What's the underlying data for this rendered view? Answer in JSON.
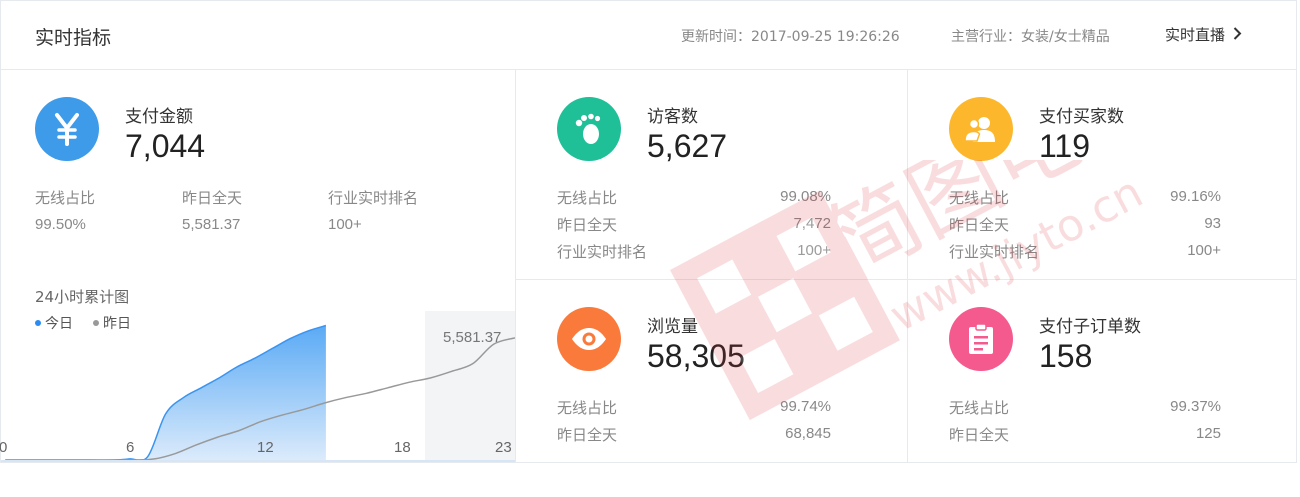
{
  "header": {
    "title": "实时指标",
    "update_time": "更新时间：2017-09-25 19:26:26",
    "industry": "主营行业：女装/女士精品",
    "live_label": "实时直播"
  },
  "payment": {
    "title": "支付金额",
    "value": "7,044",
    "icon": "yen-icon",
    "color": "#3d9be9",
    "labels": [
      "无线占比",
      "昨日全天",
      "行业实时排名"
    ],
    "values": [
      "99.50%",
      "5,581.37",
      "100+"
    ]
  },
  "chart": {
    "title": "24小时累计图",
    "legend_today": "今日",
    "legend_yesterday": "昨日",
    "today_color": "#2a8bf2",
    "yesterday_color": "#999999",
    "end_label": "5,581.37",
    "ticks": [
      "0",
      "6",
      "12",
      "18",
      "23"
    ]
  },
  "chart_data": {
    "type": "area",
    "title": "24小时累计图",
    "x": [
      0,
      2,
      4,
      6,
      7,
      8,
      9,
      10,
      11,
      12,
      13,
      14,
      15,
      16,
      17,
      18,
      19,
      20,
      21,
      22,
      23,
      24
    ],
    "series": [
      {
        "name": "今日",
        "values": [
          0,
          0,
          0,
          0,
          50,
          150,
          2100,
          2850,
          3300,
          3750,
          4250,
          4650,
          5100,
          5550,
          5900,
          6150,
          null,
          null,
          null,
          null,
          null,
          null
        ]
      },
      {
        "name": "昨日",
        "values": [
          0,
          0,
          0,
          0,
          50,
          300,
          700,
          1050,
          1350,
          1750,
          2050,
          2300,
          2600,
          2850,
          3050,
          3300,
          3550,
          3750,
          4050,
          4400,
          5300,
          5581.37
        ]
      }
    ],
    "xlim": [
      0,
      24
    ],
    "ylim": [
      0,
      6400
    ]
  },
  "visitors": {
    "title": "访客数",
    "value": "5,627",
    "icon": "footprint-icon",
    "color": "#1fbf98",
    "labels": [
      "无线占比",
      "昨日全天",
      "行业实时排名"
    ],
    "values": [
      "99.08%",
      "7,472",
      "100+"
    ]
  },
  "buyers": {
    "title": "支付买家数",
    "value": "119",
    "icon": "users-icon",
    "color": "#fdb72c",
    "labels": [
      "无线占比",
      "昨日全天",
      "行业实时排名"
    ],
    "values": [
      "99.16%",
      "93",
      "100+"
    ]
  },
  "pageviews": {
    "title": "浏览量",
    "value": "58,305",
    "icon": "eye-icon",
    "color": "#fa7a3c",
    "labels": [
      "无线占比",
      "昨日全天"
    ],
    "values": [
      "99.74%",
      "68,845"
    ]
  },
  "suborders": {
    "title": "支付子订单数",
    "value": "158",
    "icon": "clipboard-icon",
    "color": "#f45a8d",
    "labels": [
      "无线占比",
      "昨日全天"
    ],
    "values": [
      "99.37%",
      "125"
    ]
  },
  "watermark": {
    "text_cn": "简图电商",
    "text_url": "www.jiyto.cn"
  }
}
